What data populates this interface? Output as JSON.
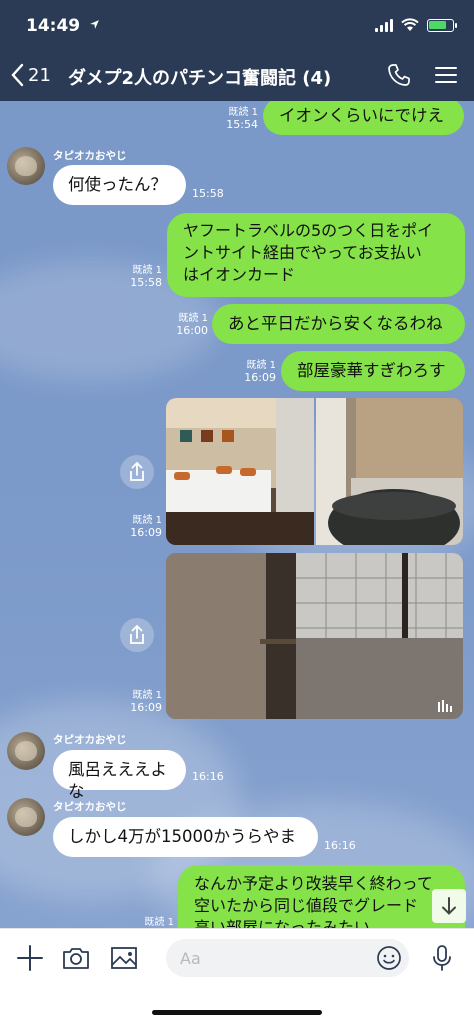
{
  "status": {
    "time": "14:49"
  },
  "header": {
    "back_count": "21",
    "title": "ダメプ2人のパチンコ奮闘記 (4)"
  },
  "messages": [
    {
      "id": "m1",
      "text": "イオンくらいにでけえ",
      "read": "既読 1",
      "time": "15:54"
    },
    {
      "id": "m2",
      "sender": "タピオカおやじ",
      "text": "何使ったん？",
      "time": "15:58"
    },
    {
      "id": "m3",
      "lines": [
        "ヤフートラベルの5のつく日をポイ",
        "ントサイト経由でやってお支払い",
        "はイオンカード"
      ],
      "read": "既読 1",
      "time": "15:58"
    },
    {
      "id": "m4",
      "text": "あと平日だから安くなるわね",
      "read": "既読 1",
      "time": "16:00"
    },
    {
      "id": "m5",
      "text": "部屋豪華すぎわろす",
      "read": "既読 1",
      "time": "16:09"
    },
    {
      "id": "m6",
      "type": "photos",
      "read": "既読 1",
      "time": "16:09"
    },
    {
      "id": "m7",
      "type": "video",
      "read": "既読 1",
      "time": "16:09"
    },
    {
      "id": "m8",
      "sender": "タピオカおやじ",
      "text": "風呂えええよな",
      "time": "16:16"
    },
    {
      "id": "m9",
      "sender": "タピオカおやじ",
      "text": "しかし4万が15000かうらやま",
      "time": "16:16"
    },
    {
      "id": "m10",
      "lines": [
        "なんか予定より改装早く終わって",
        "空いたから同じ値段でグレード",
        "高い部屋になったみたい"
      ],
      "read": "既読 1"
    }
  ],
  "input": {
    "placeholder": "Aa"
  },
  "colors": {
    "header": "#2b3b55",
    "chat_bg": "#7b99c9",
    "bubble_out": "#85e249",
    "bubble_in": "#ffffff"
  },
  "icons": [
    "location-arrow-icon",
    "signal-icon",
    "wifi-icon",
    "battery-icon",
    "back-chevron-icon",
    "phone-icon",
    "menu-icon",
    "share-icon",
    "video-icon",
    "scroll-down-icon",
    "plus-icon",
    "camera-icon",
    "image-icon",
    "emoji-icon",
    "microphone-icon"
  ]
}
